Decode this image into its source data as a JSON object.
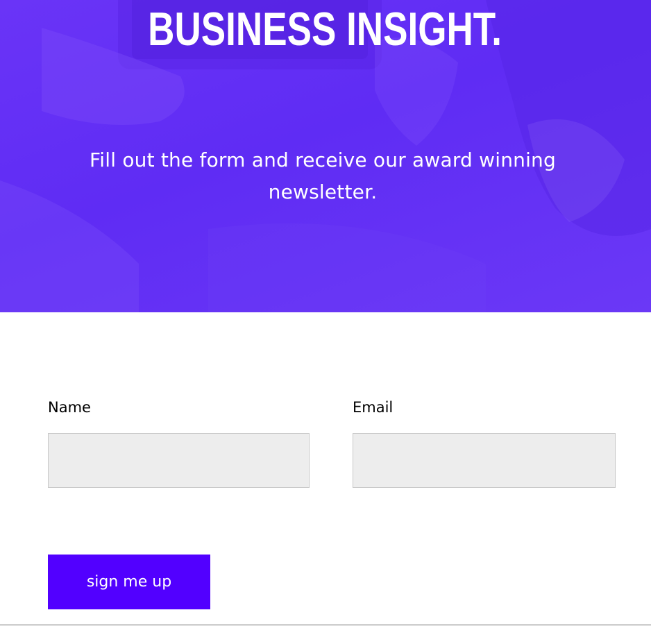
{
  "hero": {
    "title": "BUSINESS INSIGHT.",
    "subtitle": "Fill out the form and receive our award winning newsletter."
  },
  "form": {
    "name_label": "Name",
    "name_value": "",
    "email_label": "Email",
    "email_value": "",
    "submit_label": "sign me up"
  },
  "colors": {
    "hero_overlay": "#6030f5",
    "button": "#5200ff",
    "input_bg": "#ededed"
  }
}
